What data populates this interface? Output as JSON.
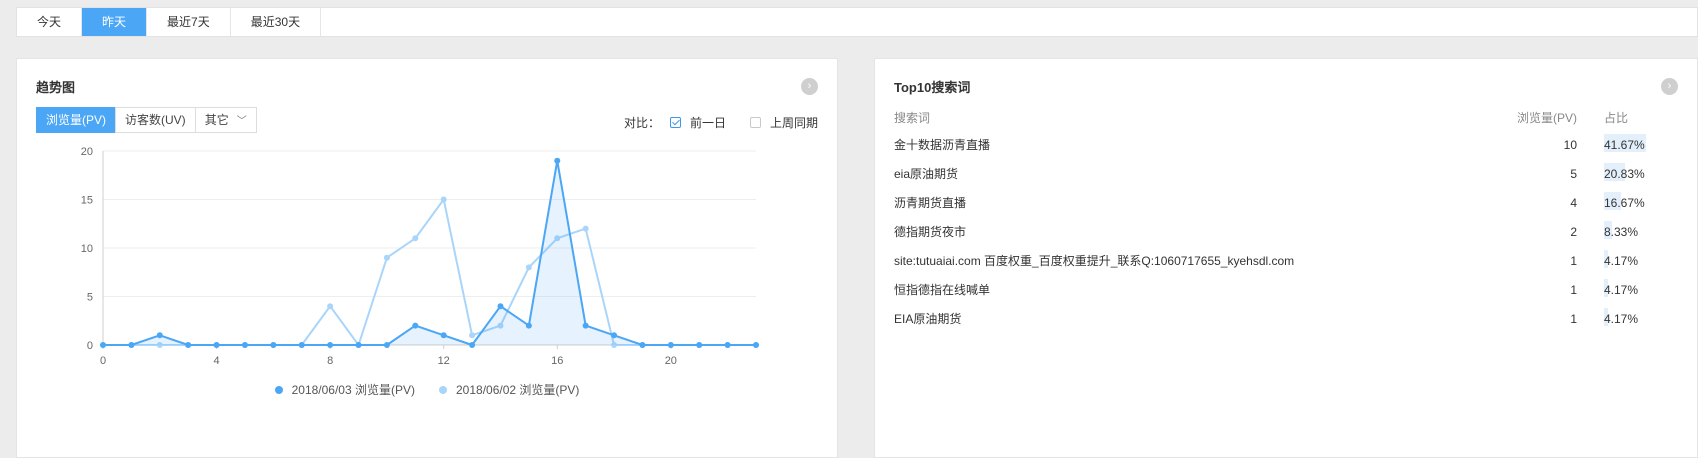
{
  "date_tabs": [
    {
      "label": "今天",
      "active": false
    },
    {
      "label": "昨天",
      "active": true
    },
    {
      "label": "最近7天",
      "active": false
    },
    {
      "label": "最近30天",
      "active": false
    }
  ],
  "trend": {
    "title": "趋势图",
    "metric_tabs": [
      {
        "label": "浏览量(PV)",
        "active": true
      },
      {
        "label": "访客数(UV)",
        "active": false
      },
      {
        "label": "其它",
        "active": false
      }
    ],
    "compare": {
      "label": "对比：",
      "options": [
        {
          "label": "前一日",
          "checked": true
        },
        {
          "label": "上周同期",
          "checked": false
        }
      ]
    }
  },
  "chart_data": {
    "type": "line",
    "x": [
      0,
      1,
      2,
      3,
      4,
      5,
      6,
      7,
      8,
      9,
      10,
      11,
      12,
      13,
      14,
      15,
      16,
      17,
      18,
      19,
      20,
      21,
      22,
      23
    ],
    "x_ticks": [
      0,
      4,
      8,
      12,
      16,
      20
    ],
    "y_ticks": [
      0,
      5,
      10,
      15,
      20
    ],
    "ylim": [
      0,
      20
    ],
    "xlim": [
      0,
      23
    ],
    "grid": true,
    "legend_position": "bottom",
    "series": [
      {
        "name": "2018/06/03 浏览量(PV)",
        "color": "#4ba6f5",
        "fill": true,
        "values": [
          0,
          0,
          1,
          0,
          0,
          0,
          0,
          0,
          0,
          0,
          0,
          2,
          1,
          0,
          4,
          2,
          19,
          2,
          1,
          0,
          0,
          0,
          0,
          0
        ]
      },
      {
        "name": "2018/06/02 浏览量(PV)",
        "color": "#a9d5fb",
        "fill": false,
        "values": [
          0,
          0,
          0,
          0,
          0,
          0,
          0,
          0,
          4,
          0,
          9,
          11,
          15,
          1,
          2,
          8,
          11,
          12,
          0,
          0,
          0,
          0,
          0,
          0
        ]
      }
    ]
  },
  "top10": {
    "title": "Top10搜索词",
    "columns": {
      "word": "搜索词",
      "pv": "浏览量(PV)",
      "ratio": "占比"
    },
    "rows": [
      {
        "word": "金十数据沥青直播",
        "pv": "10",
        "ratio": "41.67%",
        "pct": 41.67
      },
      {
        "word": "eia原油期货",
        "pv": "5",
        "ratio": "20.83%",
        "pct": 20.83
      },
      {
        "word": "沥青期货直播",
        "pv": "4",
        "ratio": "16.67%",
        "pct": 16.67
      },
      {
        "word": "德指期货夜市",
        "pv": "2",
        "ratio": "8.33%",
        "pct": 8.33
      },
      {
        "word": "site:tutuaiai.com  百度权重_百度权重提升_联系Q:1060717655_kyehsdl.com",
        "pv": "1",
        "ratio": "4.17%",
        "pct": 4.17
      },
      {
        "word": "恒指德指在线喊单",
        "pv": "1",
        "ratio": "4.17%",
        "pct": 4.17
      },
      {
        "word": "EIA原油期货",
        "pv": "1",
        "ratio": "4.17%",
        "pct": 4.17
      }
    ]
  },
  "icons": {
    "more": "chevron-right-circle-icon",
    "dropdown": "chevron-down-icon",
    "check": "checkbox-icon"
  }
}
